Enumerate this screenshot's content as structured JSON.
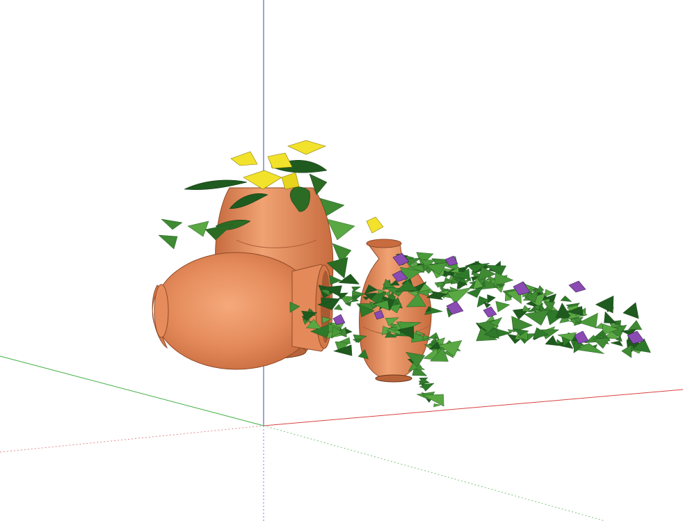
{
  "app": {
    "view": "3d-modeling-viewport",
    "background": "#ffffff"
  },
  "axes": {
    "red": "#d94040",
    "green": "#3fae3f",
    "blue": "#3b43c9"
  },
  "model": {
    "objects": [
      {
        "name": "tall-pot-with-yellow-flowers",
        "type": "terracotta-urn"
      },
      {
        "name": "tipped-over-pot",
        "type": "terracotta-urn"
      },
      {
        "name": "small-vase-with-purple-flowers",
        "type": "terracotta-vase"
      },
      {
        "name": "trailing-vine",
        "type": "foliage"
      }
    ],
    "colors": {
      "terracotta": "#e0895a",
      "terracotta_dark": "#b8643a",
      "terracotta_light": "#f3a878",
      "leaf_dark": "#1f5a1f",
      "leaf": "#3f8a33",
      "leaf_light": "#5aa843",
      "flower_yellow": "#f2e22b",
      "flower_purple": "#8a4bb3"
    }
  }
}
